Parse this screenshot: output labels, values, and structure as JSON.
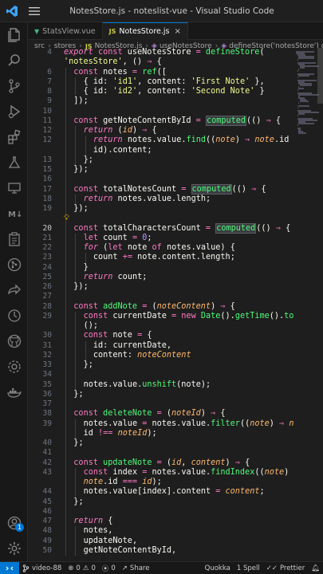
{
  "window": {
    "title": "NotesStore.js - noteslist-vue - Visual Studio Code"
  },
  "tabs": [
    {
      "label": "StatsView.vue",
      "icon": "vue-icon",
      "active": false
    },
    {
      "label": "NotesStore.js",
      "icon": "js-icon",
      "active": true
    }
  ],
  "breadcrumb": [
    "src",
    "stores",
    "NotesStore.js",
    "useNotesStore",
    "defineStore('notesStore') callback"
  ],
  "activity_bar": {
    "accounts_badge": "1"
  },
  "editor": {
    "lines": [
      {
        "n": "4",
        "i": 0,
        "h": "<span class=\"kwi\">export</span> <span class=\"kw\">const</span> <span class=\"prop\">useNotesStore</span> <span class=\"op\">=</span> <span class=\"fn\">defineStore</span><span class=\"br\">(</span>"
      },
      {
        "n": "",
        "i": 0,
        "h": "<span class=\"str\">'notesStore'</span><span class=\"pun\">,</span> <span class=\"br\">()</span> <span class=\"op\">⇒</span> <span class=\"br\">{</span>"
      },
      {
        "n": "6",
        "i": 1,
        "h": "<span class=\"kw\">const</span> <span class=\"prop\">notes</span> <span class=\"op\">=</span> <span class=\"fn\">ref</span><span class=\"br\">([</span>"
      },
      {
        "n": "7",
        "i": 2,
        "h": "<span class=\"br\">{</span> <span class=\"prop\">id</span><span class=\"pun\">:</span> <span class=\"str\">'id1'</span><span class=\"pun\">,</span> <span class=\"prop\">content</span><span class=\"pun\">:</span> <span class=\"str\">'First Note'</span> <span class=\"br\">}</span><span class=\"pun\">,</span>"
      },
      {
        "n": "8",
        "i": 2,
        "h": "<span class=\"br\">{</span> <span class=\"prop\">id</span><span class=\"pun\">:</span> <span class=\"str\">'id2'</span><span class=\"pun\">,</span> <span class=\"prop\">content</span><span class=\"pun\">:</span> <span class=\"str\">'Second Note'</span> <span class=\"br\">}</span>"
      },
      {
        "n": "9",
        "i": 1,
        "h": "<span class=\"br\">])</span><span class=\"pun\">;</span>"
      },
      {
        "n": "10",
        "i": 1,
        "h": ""
      },
      {
        "n": "11",
        "i": 1,
        "h": "<span class=\"kw\">const</span> <span class=\"prop\">getNoteContentById</span> <span class=\"op\">=</span> <span class=\"fn hl\">computed</span><span class=\"br\">(()</span> <span class=\"op\">⇒</span> <span class=\"br\">{</span>"
      },
      {
        "n": "12",
        "i": 2,
        "h": "<span class=\"kwi\">return</span> <span class=\"br\">(</span><span class=\"par\">id</span><span class=\"br\">)</span> <span class=\"op\">⇒</span> <span class=\"br\">{</span>"
      },
      {
        "n": "12",
        "i": 3,
        "h": "<span class=\"kwi\">return</span> <span class=\"prop\">notes</span><span class=\"pun\">.</span><span class=\"prop\">value</span><span class=\"pun\">.</span><span class=\"fn\">find</span><span class=\"br\">((</span><span class=\"par\">note</span><span class=\"br\">)</span> <span class=\"op\">⇒</span> <span class=\"par\">note</span><span class=\"pun\">.</span><span class=\"prop\">id</span> <span class=\"op\">===</span>"
      },
      {
        "n": "",
        "i": 3,
        "h": "<span class=\"prop\">id</span><span class=\"br\">)</span><span class=\"pun\">.</span><span class=\"prop\">content</span><span class=\"pun\">;</span>"
      },
      {
        "n": "13",
        "i": 2,
        "h": "<span class=\"br\">}</span><span class=\"pun\">;</span>"
      },
      {
        "n": "15",
        "i": 1,
        "h": "<span class=\"br\">})</span><span class=\"pun\">;</span>"
      },
      {
        "n": "16",
        "i": 1,
        "h": ""
      },
      {
        "n": "17",
        "i": 1,
        "h": "<span class=\"kw\">const</span> <span class=\"prop\">totalNotesCount</span> <span class=\"op\">=</span> <span class=\"fn hl\">computed</span><span class=\"br\">(()</span> <span class=\"op\">⇒</span> <span class=\"br\">{</span>"
      },
      {
        "n": "18",
        "i": 2,
        "h": "<span class=\"kwi\">return</span> <span class=\"prop\">notes</span><span class=\"pun\">.</span><span class=\"prop\">value</span><span class=\"pun\">.</span><span class=\"prop\">length</span><span class=\"pun\">;</span>"
      },
      {
        "n": "19",
        "i": 1,
        "h": "<span class=\"br\">})</span><span class=\"pun\">;</span>"
      },
      {
        "n": "",
        "i": 1,
        "h": "",
        "bulb": true
      },
      {
        "n": "20",
        "i": 1,
        "cur": true,
        "h": "<span class=\"kw\">const</span> <span class=\"prop\">totalCharactersCount</span> <span class=\"op\">=</span> <span class=\"fn hl\">computed</span><span class=\"br\">(()</span> <span class=\"op\">⇒</span> <span class=\"br\">{</span>"
      },
      {
        "n": "21",
        "i": 2,
        "h": "<span class=\"kw\">let</span> <span class=\"prop\">count</span> <span class=\"op\">=</span> <span class=\"num\">0</span><span class=\"pun\">;</span>"
      },
      {
        "n": "22",
        "i": 2,
        "h": "<span class=\"kwi\">for</span> <span class=\"br\">(</span><span class=\"kw\">let</span> <span class=\"prop\">note</span> <span class=\"kw\">of</span> <span class=\"prop\">notes</span><span class=\"pun\">.</span><span class=\"prop\">value</span><span class=\"br\">)</span> <span class=\"br\">{</span>"
      },
      {
        "n": "23",
        "i": 3,
        "h": "<span class=\"prop\">count</span> <span class=\"op\">+=</span> <span class=\"prop\">note</span><span class=\"pun\">.</span><span class=\"prop\">content</span><span class=\"pun\">.</span><span class=\"prop\">length</span><span class=\"pun\">;</span>"
      },
      {
        "n": "24",
        "i": 2,
        "h": "<span class=\"br\">}</span>"
      },
      {
        "n": "25",
        "i": 2,
        "h": "<span class=\"kwi\">return</span> <span class=\"prop\">count</span><span class=\"pun\">;</span>"
      },
      {
        "n": "26",
        "i": 1,
        "h": "<span class=\"br\">})</span><span class=\"pun\">;</span>"
      },
      {
        "n": "27",
        "i": 1,
        "h": ""
      },
      {
        "n": "28",
        "i": 1,
        "h": "<span class=\"kw\">const</span> <span class=\"fn\">addNote</span> <span class=\"op\">=</span> <span class=\"br\">(</span><span class=\"par\">noteContent</span><span class=\"br\">)</span> <span class=\"op\">⇒</span> <span class=\"br\">{</span>"
      },
      {
        "n": "29",
        "i": 2,
        "h": "<span class=\"kw\">const</span> <span class=\"prop\">currentDate</span> <span class=\"op\">=</span> <span class=\"kw\">new</span> <span class=\"fn\">Date</span><span class=\"br\">()</span><span class=\"pun\">.</span><span class=\"fn\">getTime</span><span class=\"br\">()</span><span class=\"pun\">.</span><span class=\"fn\">toString</span>"
      },
      {
        "n": "",
        "i": 2,
        "h": "<span class=\"br\">()</span><span class=\"pun\">;</span>"
      },
      {
        "n": "30",
        "i": 2,
        "h": "<span class=\"kw\">const</span> <span class=\"prop\">note</span> <span class=\"op\">=</span> <span class=\"br\">{</span>"
      },
      {
        "n": "31",
        "i": 3,
        "h": "<span class=\"prop\">id</span><span class=\"pun\">:</span> <span class=\"prop\">currentDate</span><span class=\"pun\">,</span>"
      },
      {
        "n": "32",
        "i": 3,
        "h": "<span class=\"prop\">content</span><span class=\"pun\">:</span> <span class=\"par\">noteContent</span>"
      },
      {
        "n": "33",
        "i": 2,
        "h": "<span class=\"br\">}</span><span class=\"pun\">;</span>"
      },
      {
        "n": "34",
        "i": 2,
        "h": ""
      },
      {
        "n": "35",
        "i": 2,
        "h": "<span class=\"prop\">notes</span><span class=\"pun\">.</span><span class=\"prop\">value</span><span class=\"pun\">.</span><span class=\"fn\">unshift</span><span class=\"br\">(</span><span class=\"prop\">note</span><span class=\"br\">)</span><span class=\"pun\">;</span>"
      },
      {
        "n": "36",
        "i": 1,
        "h": "<span class=\"br\">}</span><span class=\"pun\">;</span>"
      },
      {
        "n": "37",
        "i": 1,
        "h": ""
      },
      {
        "n": "38",
        "i": 1,
        "h": "<span class=\"kw\">const</span> <span class=\"fn\">deleteNote</span> <span class=\"op\">=</span> <span class=\"br\">(</span><span class=\"par\">noteId</span><span class=\"br\">)</span> <span class=\"op\">⇒</span> <span class=\"br\">{</span>"
      },
      {
        "n": "39",
        "i": 2,
        "h": "<span class=\"prop\">notes</span><span class=\"pun\">.</span><span class=\"prop\">value</span> <span class=\"op\">=</span> <span class=\"prop\">notes</span><span class=\"pun\">.</span><span class=\"prop\">value</span><span class=\"pun\">.</span><span class=\"fn\">filter</span><span class=\"br\">((</span><span class=\"par\">note</span><span class=\"br\">)</span> <span class=\"op\">⇒</span> <span class=\"par\">note</span><span class=\"pun\">.</span>"
      },
      {
        "n": "",
        "i": 2,
        "h": "<span class=\"prop\">id</span> <span class=\"op\">!==</span> <span class=\"par\">noteId</span><span class=\"br\">)</span><span class=\"pun\">;</span>"
      },
      {
        "n": "40",
        "i": 1,
        "h": "<span class=\"br\">}</span><span class=\"pun\">;</span>"
      },
      {
        "n": "41",
        "i": 1,
        "h": ""
      },
      {
        "n": "42",
        "i": 1,
        "h": "<span class=\"kw\">const</span> <span class=\"fn\">updateNote</span> <span class=\"op\">=</span> <span class=\"br\">(</span><span class=\"par\">id</span><span class=\"pun\">,</span> <span class=\"par\">content</span><span class=\"br\">)</span> <span class=\"op\">⇒</span> <span class=\"br\">{</span>"
      },
      {
        "n": "43",
        "i": 2,
        "h": "<span class=\"kw\">const</span> <span class=\"prop\">index</span> <span class=\"op\">=</span> <span class=\"prop\">notes</span><span class=\"pun\">.</span><span class=\"prop\">value</span><span class=\"pun\">.</span><span class=\"fn\">findIndex</span><span class=\"br\">((</span><span class=\"par\">note</span><span class=\"br\">)</span> <span class=\"op\">⇒</span>"
      },
      {
        "n": "",
        "i": 2,
        "h": "<span class=\"par\">note</span><span class=\"pun\">.</span><span class=\"prop\">id</span> <span class=\"op\">===</span> <span class=\"par\">id</span><span class=\"br\">)</span><span class=\"pun\">;</span>"
      },
      {
        "n": "44",
        "i": 2,
        "h": "<span class=\"prop\">notes</span><span class=\"pun\">.</span><span class=\"prop\">value</span><span class=\"br\">[</span><span class=\"prop\">index</span><span class=\"br\">]</span><span class=\"pun\">.</span><span class=\"prop\">content</span> <span class=\"op\">=</span> <span class=\"par\">content</span><span class=\"pun\">;</span>"
      },
      {
        "n": "45",
        "i": 1,
        "h": "<span class=\"br\">}</span><span class=\"pun\">;</span>"
      },
      {
        "n": "46",
        "i": 1,
        "h": ""
      },
      {
        "n": "47",
        "i": 1,
        "h": "<span class=\"kwi\">return</span> <span class=\"br\">{</span>"
      },
      {
        "n": "48",
        "i": 2,
        "h": "<span class=\"prop\">notes</span><span class=\"pun\">,</span>"
      },
      {
        "n": "49",
        "i": 2,
        "h": "<span class=\"prop\">updateNote</span><span class=\"pun\">,</span>"
      },
      {
        "n": "50",
        "i": 2,
        "h": "<span class=\"prop\">getNoteContentById</span><span class=\"pun\">,</span>"
      }
    ]
  },
  "status_bar": {
    "branch": "video-88",
    "errors": "0",
    "warnings": "0",
    "ports": "0",
    "share": "Share",
    "quokka": "Quokka",
    "spell": "1 Spell",
    "prettier": "Prettier"
  },
  "colors": {
    "accent": "#0078d4",
    "background": "#1e1e1e"
  }
}
